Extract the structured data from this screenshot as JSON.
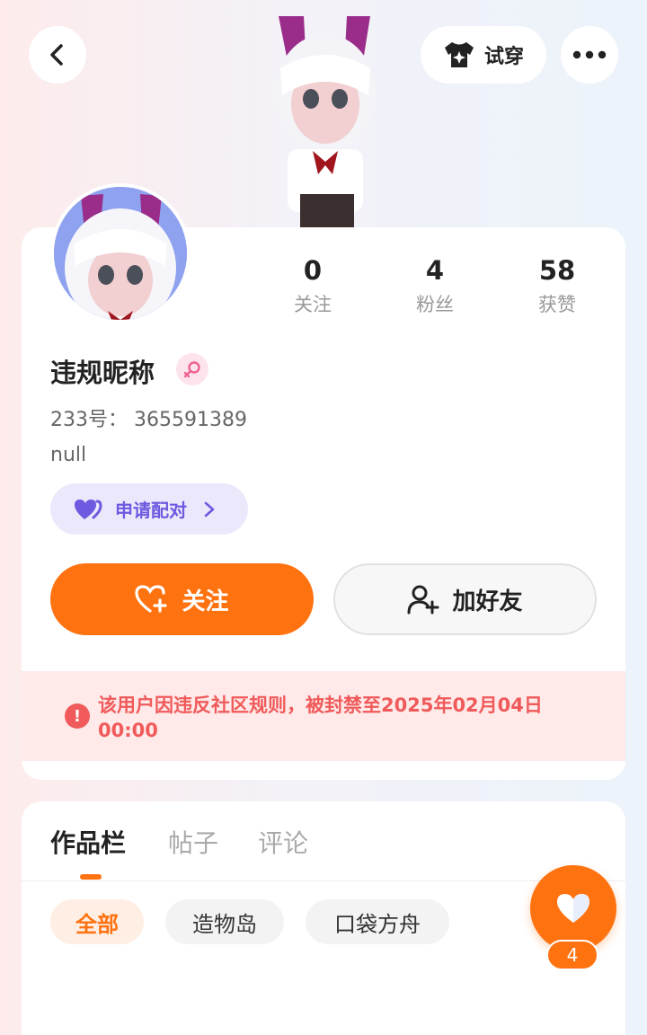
{
  "header": {
    "back_icon": "chevron-left-icon",
    "tryon_label": "试穿",
    "tryon_icon": "shirt-sparkle-icon",
    "more_icon": "more-dots-icon"
  },
  "profile": {
    "stats": [
      {
        "num": "0",
        "label": "关注"
      },
      {
        "num": "4",
        "label": "粉丝"
      },
      {
        "num": "58",
        "label": "获赞"
      }
    ],
    "nickname": "违规昵称",
    "gender_icon": "female-icon",
    "id_text": "233号：  365591389",
    "bio": "null",
    "pair_label": "申请配对"
  },
  "actions": {
    "follow_label": "关注",
    "add_friend_label": "加好友"
  },
  "ban_notice": "该用户因违反社区规则，被封禁至2025年02月04日 00:00",
  "works": {
    "tabs": [
      "作品栏",
      "帖子",
      "评论"
    ],
    "filters": [
      "全部",
      "造物岛",
      "口袋方舟"
    ]
  },
  "fab": {
    "icon": "heart-icon",
    "count": "4"
  },
  "colors": {
    "accent": "#ff7210",
    "danger": "#f05a5a",
    "pair": "#6d5ae0"
  }
}
